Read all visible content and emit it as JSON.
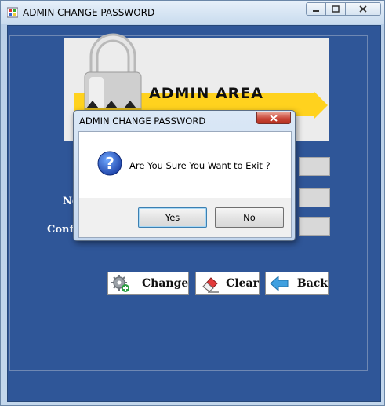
{
  "window": {
    "title": "ADMIN CHANGE PASSWORD",
    "minimize": "▭",
    "maximize": "▢",
    "close": "✕"
  },
  "banner": {
    "title": "ADMIN AREA"
  },
  "labels": {
    "new": "Ne",
    "confirm": "Confi"
  },
  "buttons": {
    "change": "Change",
    "clear": "Clear",
    "back": "Back"
  },
  "dialog": {
    "title": "ADMIN CHANGE PASSWORD",
    "close": "✕",
    "message": "Are You Sure You Want to Exit ?",
    "yes": "Yes",
    "no": "No",
    "icon": "question-icon"
  },
  "colors": {
    "client_bg": "#2f5698",
    "banner_accent": "#ffd21e",
    "close_red": "#c9483a"
  }
}
